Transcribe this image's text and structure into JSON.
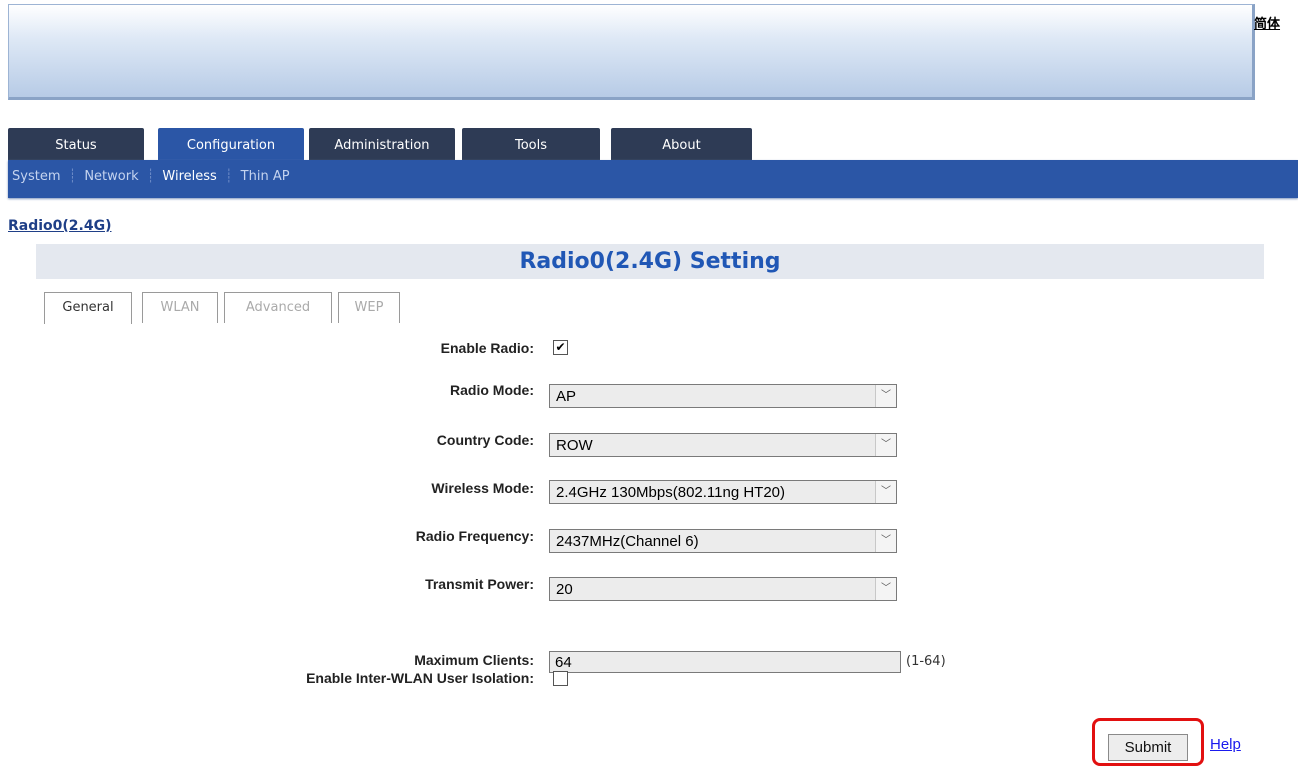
{
  "header": {
    "lang_link": "简体"
  },
  "main_tabs": [
    {
      "label": "Status"
    },
    {
      "label": "Configuration"
    },
    {
      "label": "Administration"
    },
    {
      "label": "Tools"
    },
    {
      "label": "About"
    }
  ],
  "subnav": [
    {
      "label": "System"
    },
    {
      "label": "Network"
    },
    {
      "label": "Wireless"
    },
    {
      "label": "Thin AP"
    }
  ],
  "breadcrumb": "Radio0(2.4G)",
  "section_title": "Radio0(2.4G) Setting",
  "sub_tabs": [
    {
      "label": "General"
    },
    {
      "label": "WLAN"
    },
    {
      "label": "Advanced"
    },
    {
      "label": "WEP"
    }
  ],
  "form": {
    "enable_radio": {
      "label": "Enable Radio:",
      "checked": true
    },
    "radio_mode": {
      "label": "Radio Mode:",
      "value": "AP"
    },
    "country_code": {
      "label": "Country Code:",
      "value": "ROW"
    },
    "wireless_mode": {
      "label": "Wireless Mode:",
      "value": "2.4GHz 130Mbps(802.11ng HT20)"
    },
    "radio_frequency": {
      "label": "Radio Frequency:",
      "value": "2437MHz(Channel 6)"
    },
    "transmit_power": {
      "label": "Transmit Power:",
      "value": "20"
    },
    "max_clients": {
      "label": "Maximum Clients:",
      "value": "64",
      "hint": "(1-64)"
    },
    "isolation": {
      "label": "Enable Inter-WLAN User Isolation:",
      "checked": false
    }
  },
  "actions": {
    "submit": "Submit",
    "help": "Help"
  },
  "colors": {
    "nav_dark": "#2e3b55",
    "nav_blue": "#2b56a6",
    "title_blue": "#2057b5",
    "highlight_red": "#e21010"
  },
  "icons": {
    "checked": "check-mark",
    "dropdown": "chevron-down-icon"
  }
}
